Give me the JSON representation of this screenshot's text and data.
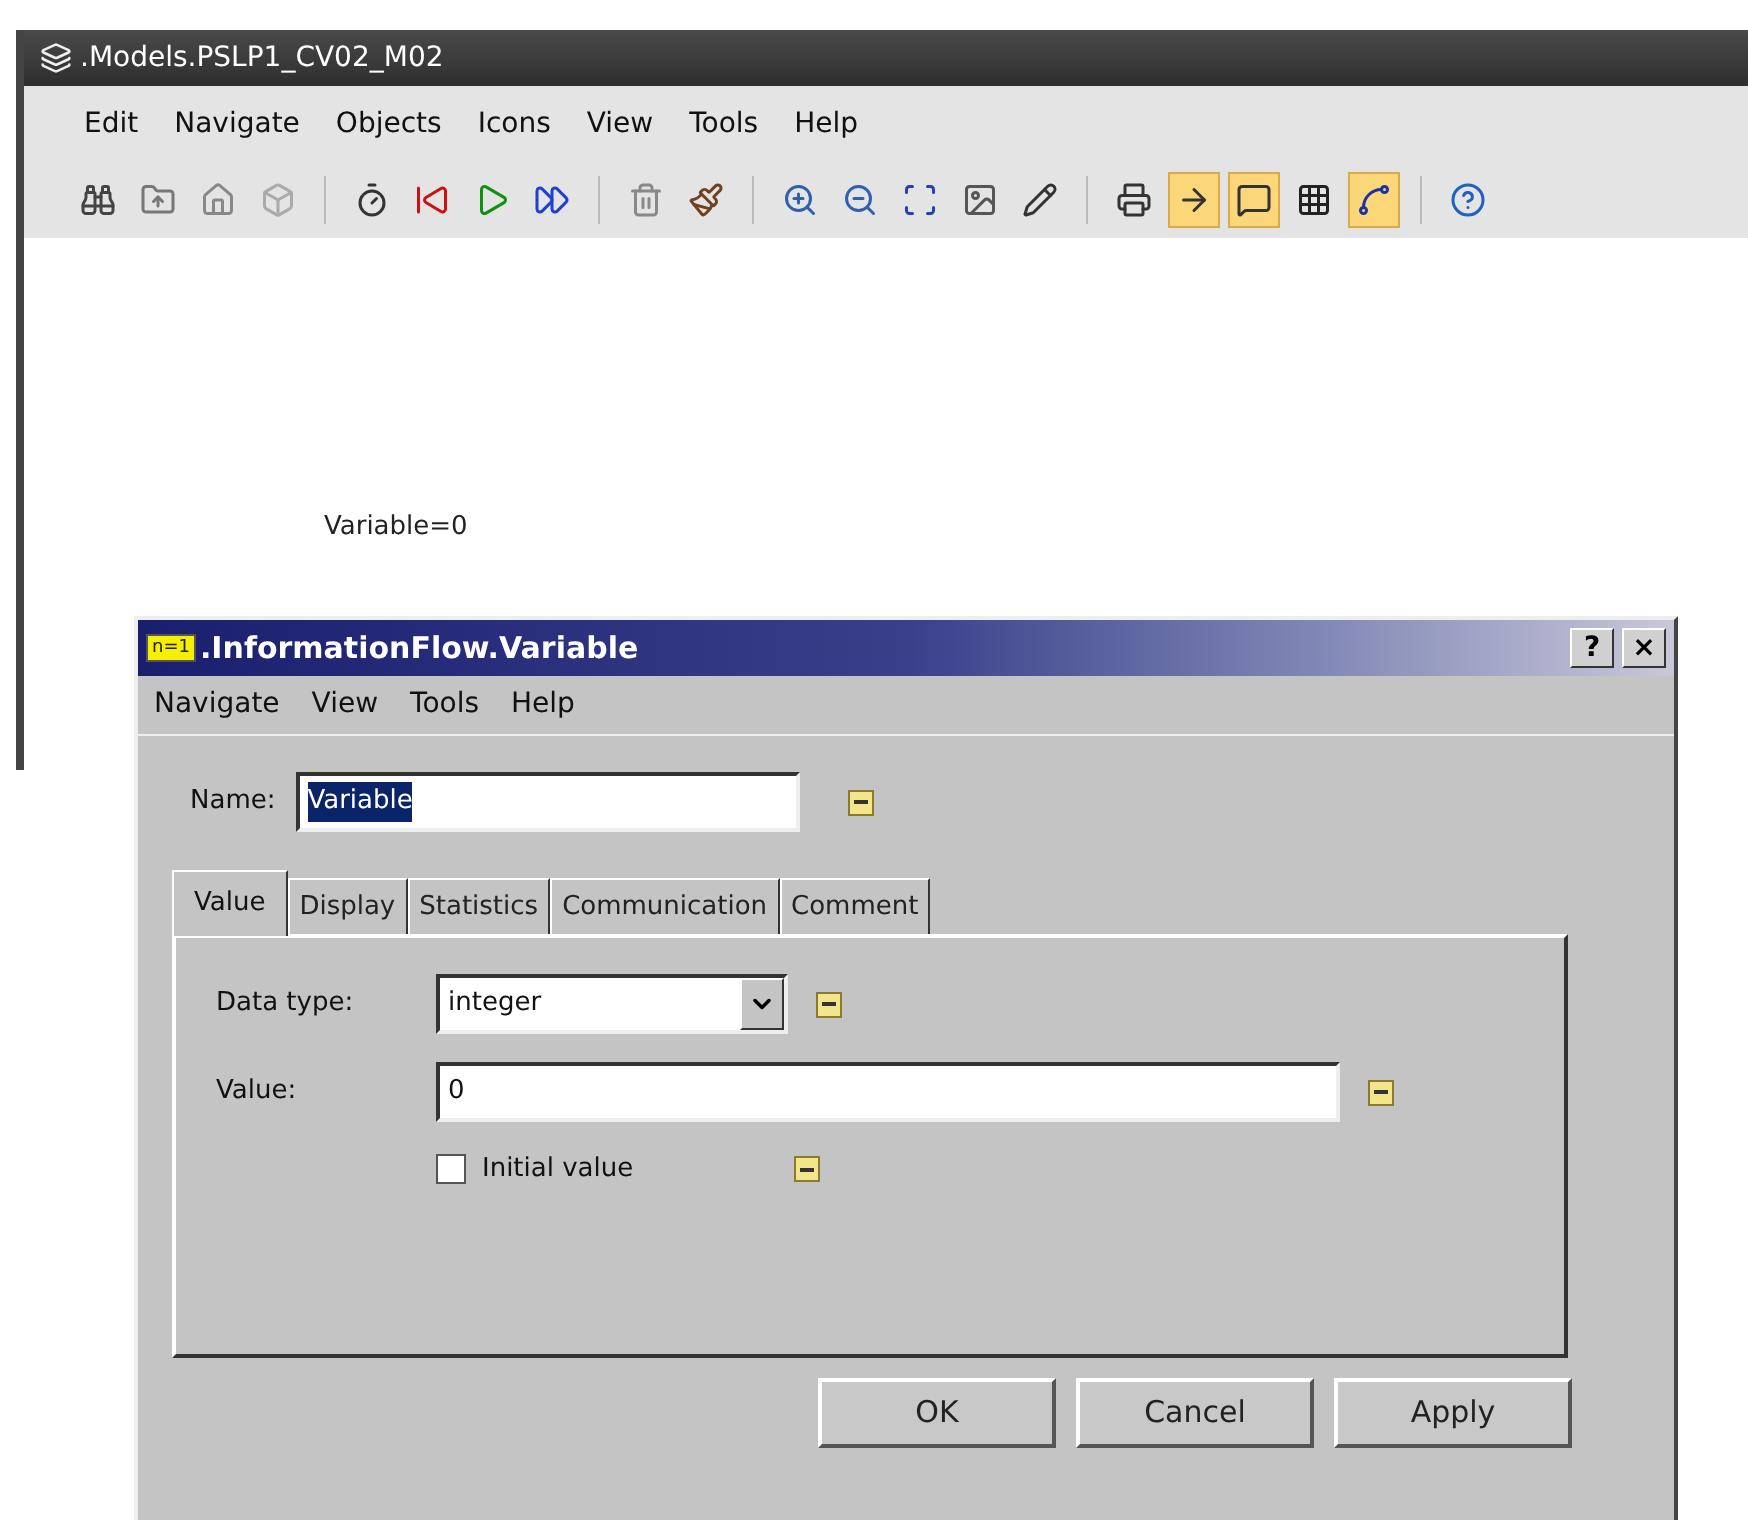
{
  "main_window": {
    "title": ".Models.PSLP1_CV02_M02",
    "menu": [
      "Edit",
      "Navigate",
      "Objects",
      "Icons",
      "View",
      "Tools",
      "Help"
    ],
    "toolbar": [
      {
        "selected": false
      },
      {
        "selected": false
      },
      {
        "selected": false
      },
      {
        "selected": false
      },
      {
        "selected": false
      },
      {
        "selected": false
      },
      {
        "selected": false
      },
      {
        "selected": false
      },
      {
        "selected": false
      },
      {
        "selected": false
      },
      {
        "selected": false
      },
      {
        "selected": false
      },
      {
        "selected": false
      },
      {
        "selected": false
      },
      {
        "selected": false
      },
      {
        "selected": false
      },
      {
        "selected": true
      },
      {
        "selected": true
      },
      {
        "selected": false
      },
      {
        "selected": true
      },
      {
        "selected": false
      }
    ],
    "canvas_label": "Variable=0"
  },
  "dialog": {
    "icon_text": "n=1",
    "title": ".InformationFlow.Variable",
    "title_buttons": [
      "?",
      "×"
    ],
    "menu": [
      "Navigate",
      "View",
      "Tools",
      "Help"
    ],
    "name": {
      "label": "Name:",
      "value": "Variable"
    },
    "tabs": [
      {
        "label": "Value",
        "selected": true
      },
      {
        "label": "Display",
        "selected": false
      },
      {
        "label": "Statistics",
        "selected": false
      },
      {
        "label": "Communication",
        "selected": false
      },
      {
        "label": "Comment",
        "selected": false
      }
    ],
    "data_type": {
      "label": "Data type:",
      "value": "integer"
    },
    "value": {
      "label": "Value:",
      "value": "0"
    },
    "initial_value": {
      "label": "Initial value",
      "checked": false
    },
    "buttons": [
      "OK",
      "Cancel",
      "Apply"
    ]
  }
}
